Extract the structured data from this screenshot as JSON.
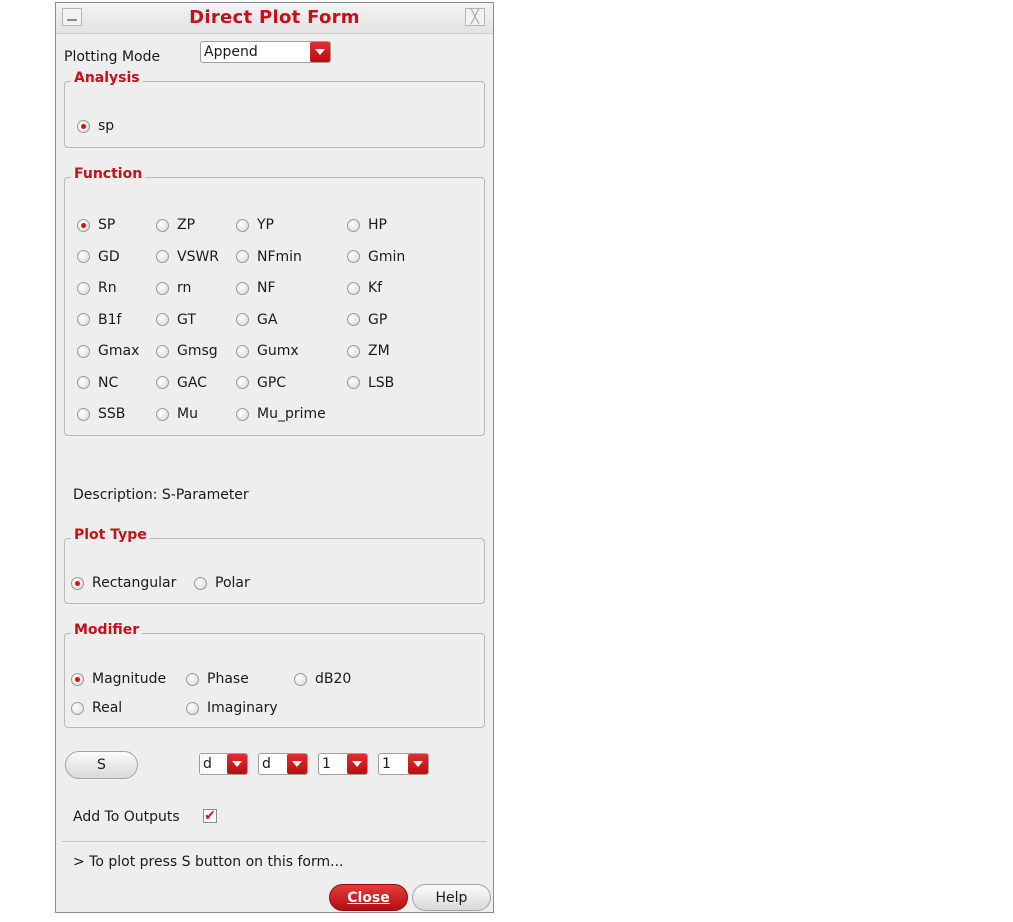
{
  "window": {
    "title": "Direct Plot Form",
    "close_glyph": "╳"
  },
  "plotting_mode": {
    "label": "Plotting Mode",
    "value": "Append"
  },
  "analysis": {
    "title": "Analysis",
    "options": [
      "sp"
    ],
    "selected": "sp"
  },
  "function": {
    "title": "Function",
    "rows": [
      [
        "SP",
        "ZP",
        "YP",
        "HP"
      ],
      [
        "GD",
        "VSWR",
        "NFmin",
        "Gmin"
      ],
      [
        "Rn",
        "rn",
        "NF",
        "Kf"
      ],
      [
        "B1f",
        "GT",
        "GA",
        "GP"
      ],
      [
        "Gmax",
        "Gmsg",
        "Gumx",
        "ZM"
      ],
      [
        "NC",
        "GAC",
        "GPC",
        "LSB"
      ],
      [
        "SSB",
        "Mu",
        "Mu_prime"
      ]
    ],
    "selected": "SP"
  },
  "description": "Description: S-Parameter",
  "plot_type": {
    "title": "Plot Type",
    "options": [
      "Rectangular",
      "Polar"
    ],
    "selected": "Rectangular"
  },
  "modifier": {
    "title": "Modifier",
    "options": [
      "Magnitude",
      "Phase",
      "dB20",
      "Real",
      "Imaginary"
    ],
    "selected": "Magnitude"
  },
  "s_button": {
    "label": "S"
  },
  "port_selectors": [
    "d",
    "d",
    "1",
    "1"
  ],
  "add_to_outputs": {
    "label": "Add To Outputs",
    "checked": true,
    "check_glyph": "✔"
  },
  "status_message": "> To plot press S button on this form...",
  "footer": {
    "close_label": "Close",
    "help_label": "Help"
  },
  "colors": {
    "accent": "#c4111b",
    "radio_dot": "#d01717"
  }
}
